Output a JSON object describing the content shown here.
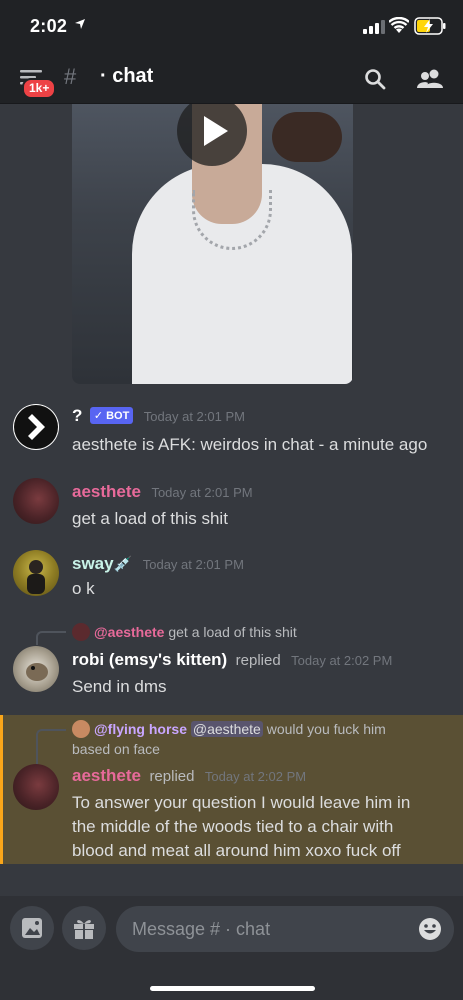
{
  "status_bar": {
    "time": "2:02"
  },
  "header": {
    "badge": "1k+",
    "hash": "#",
    "title": "· chat"
  },
  "video": {
    "icon": "play-icon"
  },
  "messages": [
    {
      "username": "?",
      "tag": "✓ BOT",
      "timestamp": "Today at 2:01 PM",
      "text": "aesthete is AFK: weirdos in chat - a minute ago",
      "name_color": "#ffffff"
    },
    {
      "username": "aesthete",
      "timestamp": "Today at 2:01 PM",
      "text": "get a load of this shit",
      "name_color": "#e76a9a"
    },
    {
      "username": "sway",
      "emoji": "💉",
      "timestamp": "Today at 2:01 PM",
      "text": "o k",
      "name_color": "#c9f3e8"
    },
    {
      "reply_to": "@aesthete",
      "reply_text": "get a load of this shit",
      "username": "robi (emsy's kitten)",
      "replied": "replied",
      "timestamp": "Today at 2:02 PM",
      "text": "Send in dms",
      "name_color": "#ffffff"
    },
    {
      "reply_to": "@flying horse",
      "reply_mention": "@aesthete",
      "reply_text": "would you fuck him",
      "reply_text_2": "based on face",
      "username": "aesthete",
      "replied": "replied",
      "timestamp": "Today at 2:02 PM",
      "lines": [
        "To answer your question I would leave him in",
        "the middle of the woods tied to a chair with",
        "blood and meat all around him xoxo fuck off"
      ],
      "name_color": "#e76a9a",
      "highlight_color": "#faa61a"
    }
  ],
  "input": {
    "placeholder": "Message # · chat"
  }
}
